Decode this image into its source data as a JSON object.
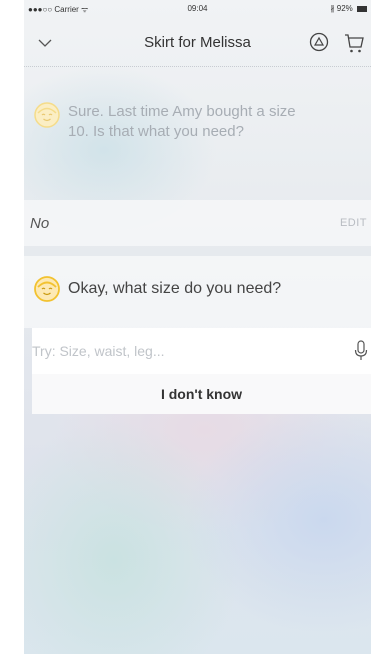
{
  "status_bar": {
    "carrier": "●●●○○ Carrier ᯤ",
    "time": "09:04",
    "battery": "∦ 92%"
  },
  "nav": {
    "title": "Skirt for Melissa",
    "icons": [
      "chevron-down-icon",
      "bot-icon",
      "cart-icon"
    ]
  },
  "conversation": {
    "previous_bot_message": "Sure. Last time Amy bought a size 10. Is that what you need?",
    "user_answer": "No",
    "edit_label": "EDIT",
    "current_bot_message": "Okay, what size do you need?"
  },
  "input": {
    "placeholder": "Try: Size, waist, leg...",
    "value": ""
  },
  "suggestion": {
    "label": "I don't know"
  },
  "colors": {
    "avatar_face": "#f2c230",
    "avatar_face_faded": "#f5dc8a",
    "text_dark": "#333333",
    "text_muted": "#a7adb4"
  }
}
